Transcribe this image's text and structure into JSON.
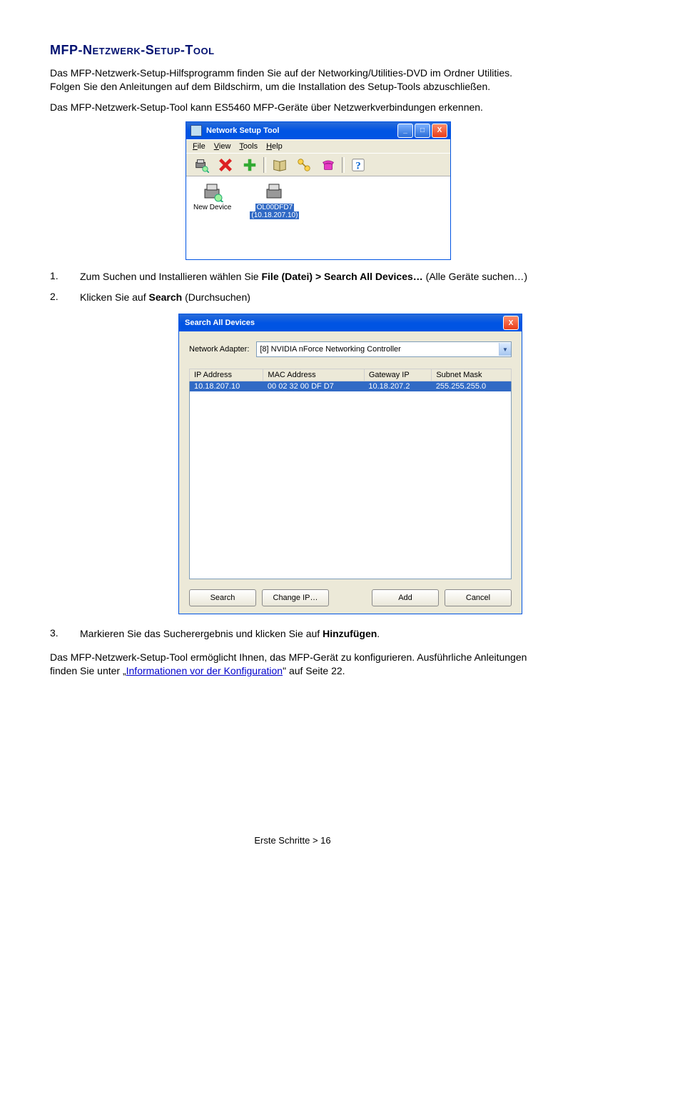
{
  "heading": "MFP-Netzwerk-Setup-Tool",
  "intro": {
    "p1": "Das MFP-Netzwerk-Setup-Hilfsprogramm finden Sie auf der Networking/Utilities-DVD im Ordner Utilities. Folgen Sie den Anleitungen auf dem Bildschirm, um die Installation des Setup-Tools abzuschließen.",
    "p2": "Das MFP-Netzwerk-Setup-Tool kann ES5460 MFP-Geräte über Netzwerkverbindungen erkennen."
  },
  "steps": {
    "s1_num": "1.",
    "s1_a": "Zum Suchen und Installieren wählen Sie ",
    "s1_b": "File (Datei) > Search All Devices…",
    "s1_c": " (Alle Geräte suchen…)",
    "s2_num": "2.",
    "s2_a": "Klicken Sie auf ",
    "s2_b": "Search",
    "s2_c": " (Durchsuchen)",
    "s3_num": "3.",
    "s3_a": "Markieren Sie das Sucherergebnis und klicken Sie auf ",
    "s3_b": "Hinzufügen",
    "s3_c": "."
  },
  "outro": {
    "a": "Das MFP-Netzwerk-Setup-Tool ermöglicht Ihnen, das MFP-Gerät zu konfigurieren. Ausführliche Anleitungen finden Sie unter „",
    "link": "Informationen vor der Konfiguration",
    "b": "\" auf Seite 22."
  },
  "win1": {
    "title": "Network Setup Tool",
    "menu": {
      "file": "File",
      "view": "View",
      "tools": "Tools",
      "help": "Help"
    },
    "dev1": {
      "label": "New Device"
    },
    "dev2": {
      "label": "OL00DFD7",
      "ip": "(10.18.207.10)"
    }
  },
  "win2": {
    "title": "Search All Devices",
    "adapter_label": "Network Adapter:",
    "adapter_value": "[8] NVIDIA nForce Networking Controller",
    "cols": {
      "ip": "IP Address",
      "mac": "MAC Address",
      "gw": "Gateway IP",
      "mask": "Subnet Mask"
    },
    "row": {
      "ip": "10.18.207.10",
      "mac": "00 02 32 00 DF D7",
      "gw": "10.18.207.2",
      "mask": "255.255.255.0"
    },
    "buttons": {
      "search": "Search",
      "change": "Change IP…",
      "add": "Add",
      "cancel": "Cancel"
    }
  },
  "footer": "Erste Schritte > 16"
}
